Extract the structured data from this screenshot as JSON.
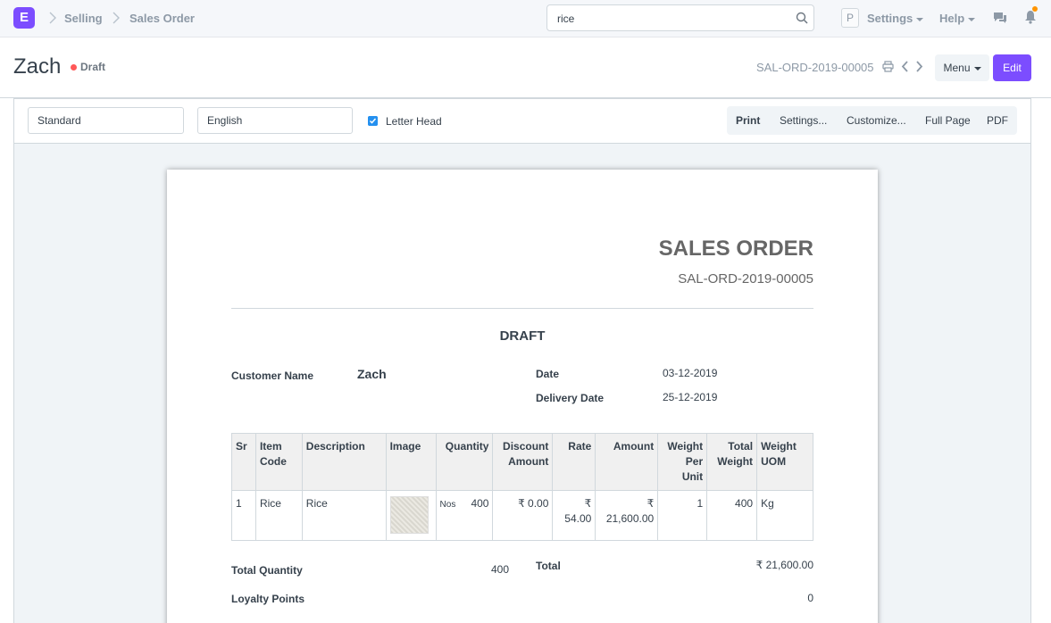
{
  "navbar": {
    "logo_letter": "E",
    "breadcrumbs": [
      "Selling",
      "Sales Order"
    ],
    "search_value": "rice",
    "avatar_letter": "P",
    "settings_label": "Settings",
    "help_label": "Help"
  },
  "page": {
    "title": "Zach",
    "status": "Draft",
    "docname": "SAL-ORD-2019-00005",
    "menu_label": "Menu",
    "edit_label": "Edit"
  },
  "print_toolbar": {
    "format": "Standard",
    "language": "English",
    "letter_head_label": "Letter Head",
    "letter_head_checked": true,
    "actions": [
      "Print",
      "Settings...",
      "Customize...",
      "Full Page",
      "PDF"
    ]
  },
  "document": {
    "heading": "SALES ORDER",
    "subheading": "SAL-ORD-2019-00005",
    "watermark": "DRAFT",
    "customer_label": "Customer Name",
    "customer_value": "Zach",
    "date_label": "Date",
    "date_value": "03-12-2019",
    "delivery_label": "Delivery Date",
    "delivery_value": "25-12-2019",
    "columns": [
      "Sr",
      "Item Code",
      "Description",
      "Image",
      "Quantity",
      "Discount Amount",
      "Rate",
      "Amount",
      "Weight Per Unit",
      "Total Weight",
      "Weight UOM"
    ],
    "rows": [
      {
        "sr": "1",
        "item_code": "Rice",
        "description": "Rice",
        "uom": "Nos",
        "qty": "400",
        "discount": "₹ 0.00",
        "rate": "₹ 54.00",
        "amount": "₹ 21,600.00",
        "weight_per_unit": "1",
        "total_weight": "400",
        "weight_uom": "Kg"
      }
    ],
    "total_qty_label": "Total Quantity",
    "total_qty_value": "400",
    "total_label": "Total",
    "total_value": "₹ 21,600.00",
    "loyalty_label": "Loyalty Points",
    "loyalty_value": "0"
  }
}
